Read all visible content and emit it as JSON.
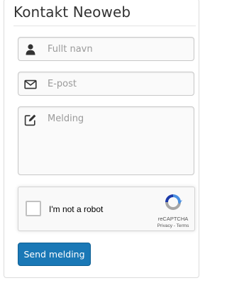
{
  "form": {
    "title": "Kontakt Neoweb",
    "name_field": {
      "placeholder": "Fullt navn",
      "value": "",
      "icon": "user-icon"
    },
    "email_field": {
      "placeholder": "E-post",
      "value": "",
      "icon": "envelope-icon"
    },
    "message_field": {
      "placeholder": "Melding",
      "value": "",
      "icon": "edit-icon"
    },
    "submit_label": "Send melding",
    "accent_color": "#1a78b6"
  },
  "recaptcha": {
    "label": "I'm not a robot",
    "brand": "reCAPTCHA",
    "privacy_label": "Privacy",
    "separator": " - ",
    "terms_label": "Terms",
    "checked": false
  }
}
